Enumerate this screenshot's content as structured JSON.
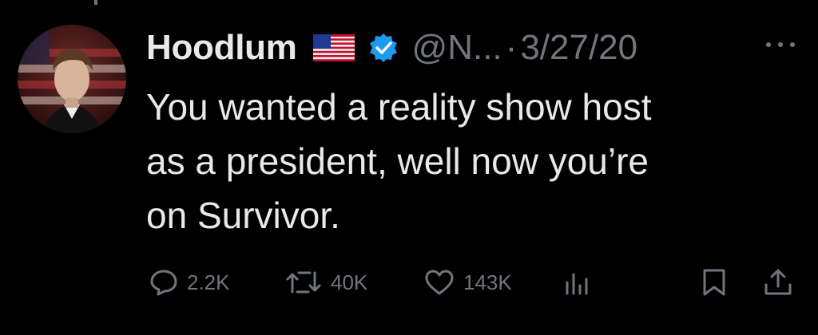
{
  "header": {
    "display_name": "Hoodlum",
    "handle": "@N...",
    "separator": "·",
    "date": "3/27/20"
  },
  "icons": {
    "flag": "us-flag-icon",
    "verified": "verified-badge-icon",
    "more": "more-options-icon"
  },
  "tweet": {
    "lines": [
      "You wanted a reality show host",
      "as a president, well now you’re",
      "on Survivor."
    ]
  },
  "actions": {
    "replies": "2.2K",
    "reposts": "40K",
    "likes": "143K"
  },
  "colors": {
    "background": "#000000",
    "text": "#e7e9ea",
    "muted": "#71767b",
    "verified": "#1d9bf0"
  }
}
